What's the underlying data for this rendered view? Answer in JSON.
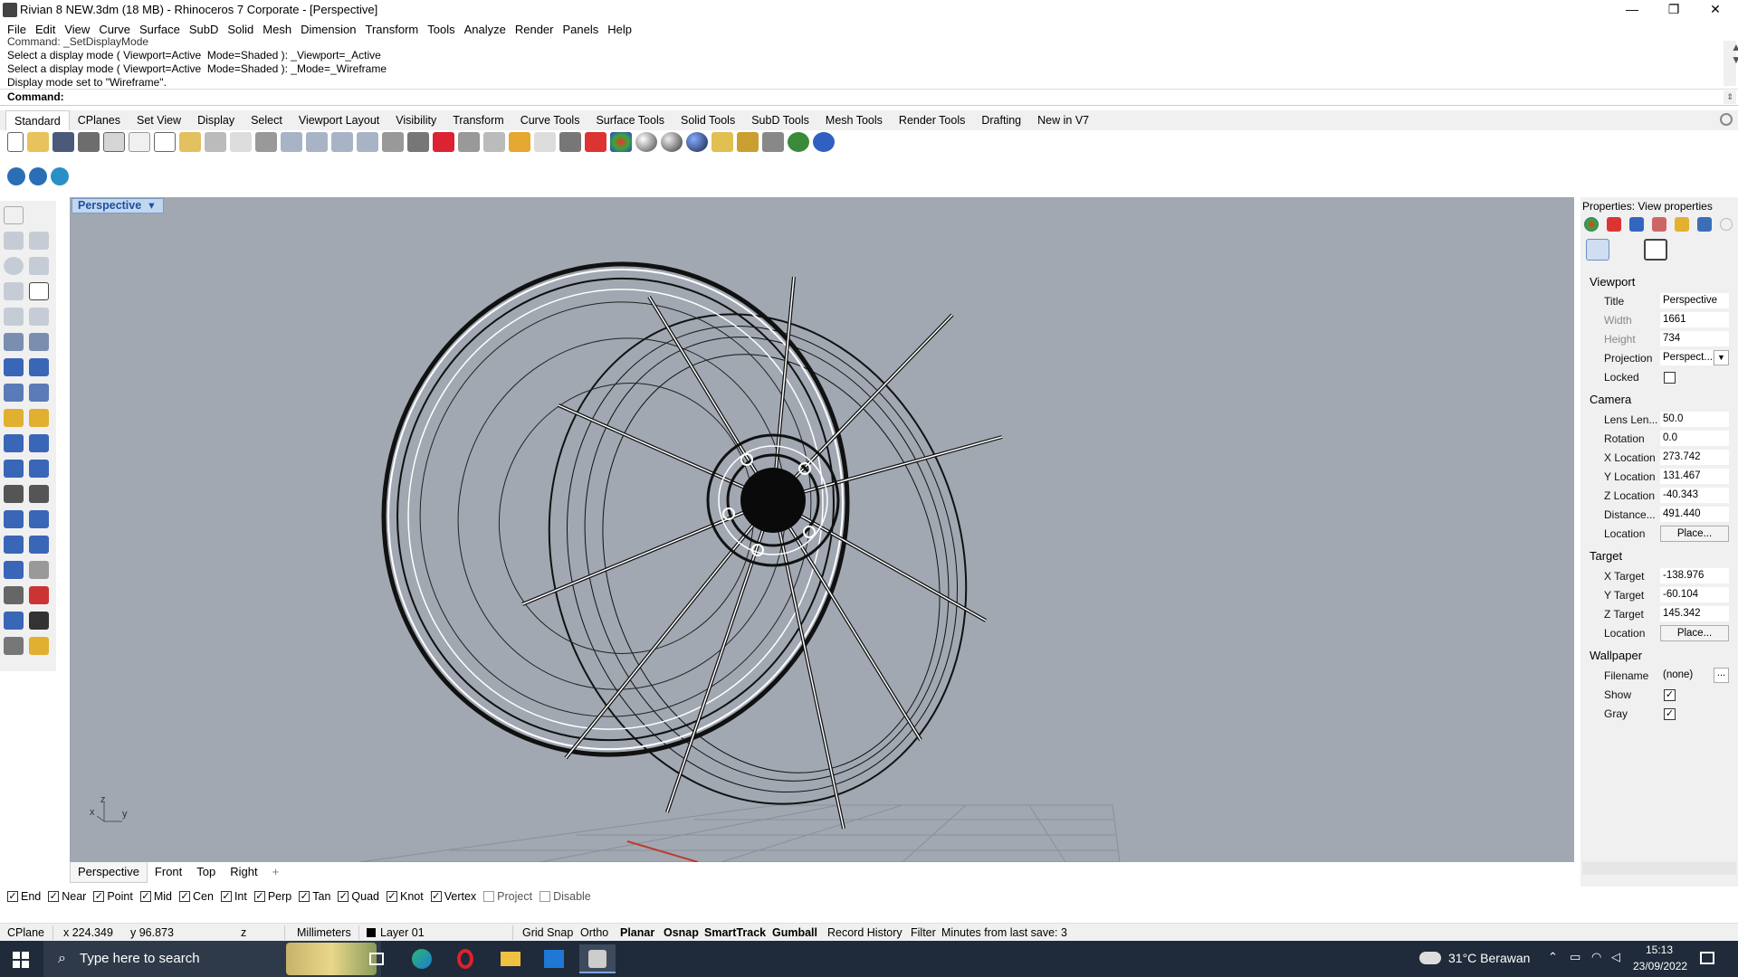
{
  "window": {
    "title": "Rivian 8 NEW.3dm (18 MB) - Rhinoceros 7 Corporate - [Perspective]",
    "minimize": "—",
    "maximize": "❐",
    "close": "✕"
  },
  "menu": [
    "File",
    "Edit",
    "View",
    "Curve",
    "Surface",
    "SubD",
    "Solid",
    "Mesh",
    "Dimension",
    "Transform",
    "Tools",
    "Analyze",
    "Render",
    "Panels",
    "Help"
  ],
  "command_history": [
    "Command: _SetDisplayMode",
    "Select a display mode ( Viewport=Active  Mode=Shaded ): _Viewport=_Active",
    "Select a display mode ( Viewport=Active  Mode=Shaded ): _Mode=_Wireframe",
    "Display mode set to \"Wireframe\"."
  ],
  "command_prompt": "Command:",
  "toolbar_tabs": [
    "Standard",
    "CPlanes",
    "Set View",
    "Display",
    "Select",
    "Viewport Layout",
    "Visibility",
    "Transform",
    "Curve Tools",
    "Surface Tools",
    "Solid Tools",
    "SubD Tools",
    "Mesh Tools",
    "Render Tools",
    "Drafting",
    "New in V7"
  ],
  "viewport": {
    "name": "Perspective",
    "axis_x": "x",
    "axis_y": "y",
    "axis_z": "z"
  },
  "viewport_tabs": [
    "Perspective",
    "Front",
    "Top",
    "Right"
  ],
  "viewport_tab_add": "+",
  "osnaps": [
    {
      "label": "End",
      "checked": true
    },
    {
      "label": "Near",
      "checked": true
    },
    {
      "label": "Point",
      "checked": true
    },
    {
      "label": "Mid",
      "checked": true
    },
    {
      "label": "Cen",
      "checked": true
    },
    {
      "label": "Int",
      "checked": true
    },
    {
      "label": "Perp",
      "checked": true
    },
    {
      "label": "Tan",
      "checked": true
    },
    {
      "label": "Quad",
      "checked": true
    },
    {
      "label": "Knot",
      "checked": true
    },
    {
      "label": "Vertex",
      "checked": true
    },
    {
      "label": "Project",
      "checked": false
    },
    {
      "label": "Disable",
      "checked": false
    }
  ],
  "status": {
    "cplane": "CPlane",
    "x": "x 224.349",
    "y": "y 96.873",
    "z": "z",
    "units": "Millimeters",
    "layer": "Layer 01",
    "grid_snap": "Grid Snap",
    "ortho": "Ortho",
    "planar": "Planar",
    "osnap": "Osnap",
    "smarttrack": "SmartTrack",
    "gumball": "Gumball",
    "record_history": "Record History",
    "filter": "Filter",
    "save_info": "Minutes from last save: 3"
  },
  "properties": {
    "header": "Properties: View properties",
    "viewport_section": "Viewport",
    "title_label": "Title",
    "title_value": "Perspective",
    "width_label": "Width",
    "width_value": "1661",
    "height_label": "Height",
    "height_value": "734",
    "projection_label": "Projection",
    "projection_value": "Perspect...",
    "locked_label": "Locked",
    "locked": false,
    "camera_section": "Camera",
    "lens_label": "Lens Len...",
    "lens_value": "50.0",
    "rotation_label": "Rotation",
    "rotation_value": "0.0",
    "xloc_label": "X Location",
    "xloc_value": "273.742",
    "yloc_label": "Y Location",
    "yloc_value": "131.467",
    "zloc_label": "Z Location",
    "zloc_value": "-40.343",
    "distance_label": "Distance...",
    "distance_value": "491.440",
    "location_label": "Location",
    "location_button": "Place...",
    "target_section": "Target",
    "xtarget_label": "X Target",
    "xtarget_value": "-138.976",
    "ytarget_label": "Y Target",
    "ytarget_value": "-60.104",
    "ztarget_label": "Z Target",
    "ztarget_value": "145.342",
    "tlocation_label": "Location",
    "tlocation_button": "Place...",
    "wallpaper_section": "Wallpaper",
    "filename_label": "Filename",
    "filename_value": "(none)",
    "browse": "...",
    "show_label": "Show",
    "show": true,
    "gray_label": "Gray",
    "gray": true
  },
  "taskbar": {
    "search_placeholder": "Type here to search",
    "weather": "31°C  Berawan",
    "time": "15:13",
    "date": "23/09/2022"
  }
}
